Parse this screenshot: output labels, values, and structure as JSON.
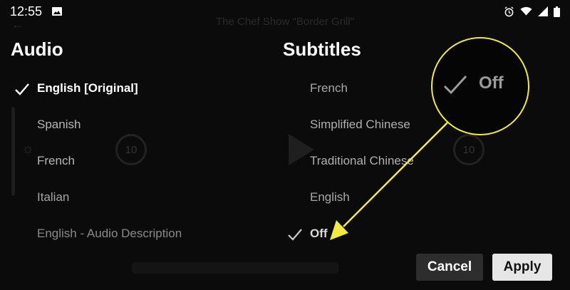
{
  "status_bar": {
    "time": "12:55",
    "icons": [
      "image-icon",
      "alarm-icon",
      "wifi-icon",
      "signal-icon",
      "battery-icon"
    ]
  },
  "background_player": {
    "title": "The Chef Show \"Border Grill\"",
    "rewind_label": "10",
    "forward_label": "10"
  },
  "audio": {
    "heading": "Audio",
    "selected": "English [Original]",
    "items": [
      "English [Original]",
      "Spanish",
      "French",
      "Italian",
      "English - Audio Description"
    ]
  },
  "subtitles": {
    "heading": "Subtitles",
    "selected": "Off",
    "items": [
      "French",
      "Simplified Chinese",
      "Traditional Chinese",
      "English",
      "Off"
    ]
  },
  "buttons": {
    "cancel": "Cancel",
    "apply": "Apply"
  },
  "callout": {
    "label": "Off",
    "accent_color": "#f1ea42"
  }
}
